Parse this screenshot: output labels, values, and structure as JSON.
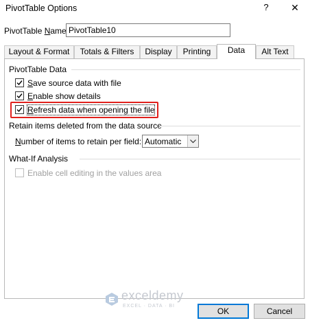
{
  "window": {
    "title": "PivotTable Options",
    "help_glyph": "?",
    "close_glyph": "✕"
  },
  "name_field": {
    "label_pre": "PivotTable ",
    "label_underlined": "N",
    "label_post": "ame:",
    "value": "PivotTable10"
  },
  "tabs": [
    {
      "label": "Layout & Format"
    },
    {
      "label": "Totals & Filters"
    },
    {
      "label": "Display"
    },
    {
      "label": "Printing"
    },
    {
      "label": "Data",
      "active": true
    },
    {
      "label": "Alt Text"
    }
  ],
  "pivot_data": {
    "title": "PivotTable Data",
    "options": [
      {
        "u": "S",
        "rest": "ave source data with file",
        "checked": true
      },
      {
        "u": "E",
        "rest": "nable show details",
        "checked": true
      },
      {
        "u": "R",
        "rest": "efresh data when opening the file",
        "checked": true
      }
    ]
  },
  "retain": {
    "title": "Retain items deleted from the data source",
    "label_u": "N",
    "label_rest": "umber of items to retain per field:",
    "selected": "Automatic"
  },
  "whatif": {
    "title": "What-If Analysis",
    "option": "Enable cell editing in the values area",
    "checked": false,
    "disabled": true
  },
  "watermark": {
    "brand": "exceldemy",
    "tagline": "EXCEL · DATA · BI"
  },
  "buttons": {
    "ok": "OK",
    "cancel": "Cancel"
  },
  "colors": {
    "highlight": "#e0201c",
    "default_button_border": "#0078d7"
  }
}
